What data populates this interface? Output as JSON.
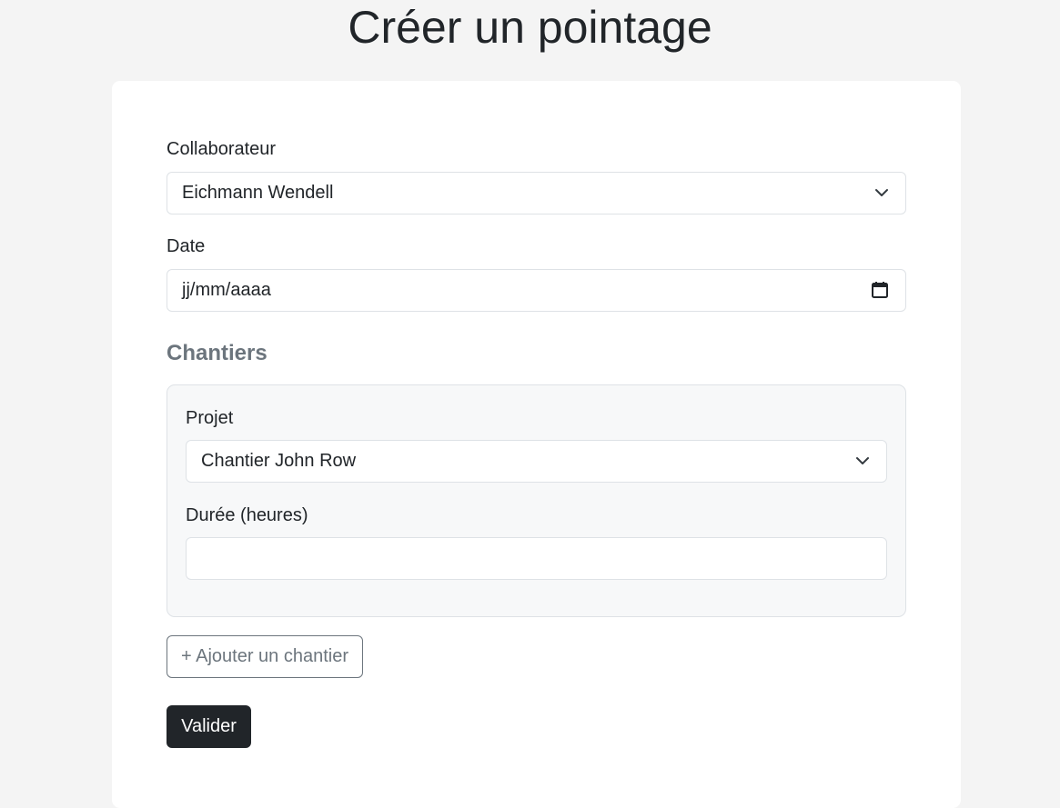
{
  "page": {
    "title": "Créer un pointage"
  },
  "form": {
    "collaborateur": {
      "label": "Collaborateur",
      "value": "Eichmann Wendell"
    },
    "date": {
      "label": "Date",
      "placeholder": "jj/mm/aaaa"
    },
    "section_title": "Chantiers",
    "chantier": {
      "projet": {
        "label": "Projet",
        "value": "Chantier John Row"
      },
      "duree": {
        "label": "Durée (heures)",
        "value": ""
      }
    },
    "add_button": "+ Ajouter un chantier",
    "submit_button": "Valider"
  },
  "icons": {
    "select_arrow": "chevron-down-icon",
    "date_picker": "calendar-icon"
  }
}
